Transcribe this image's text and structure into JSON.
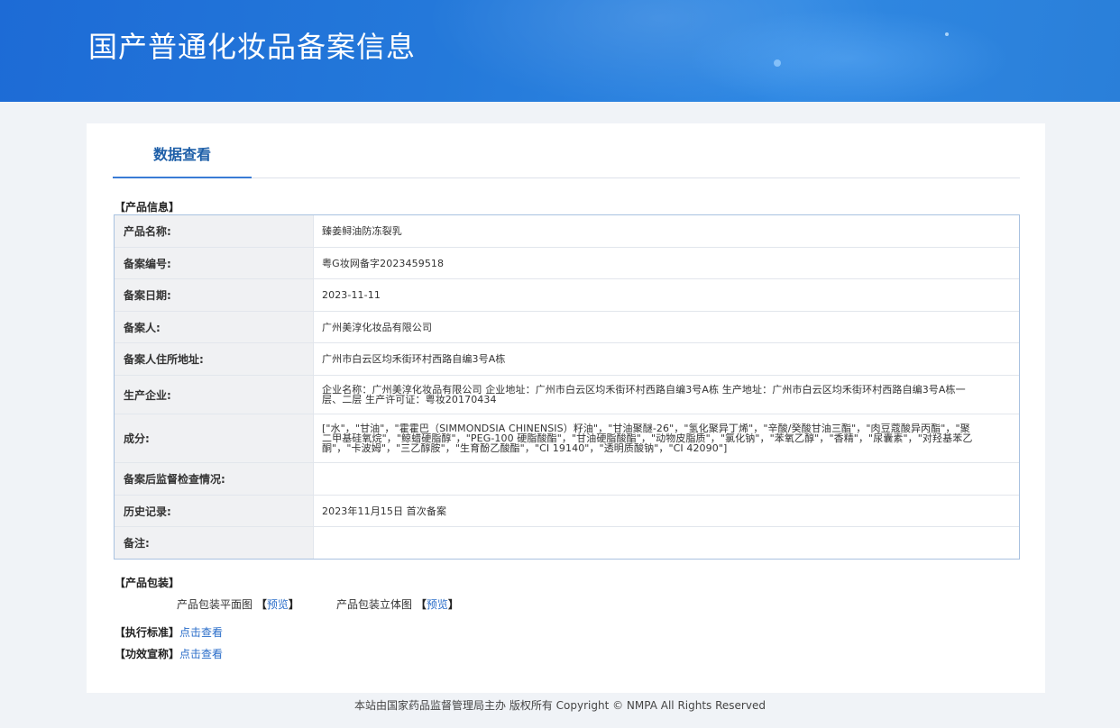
{
  "header": {
    "title": "国产普通化妆品备案信息"
  },
  "tab": {
    "label": "数据查看"
  },
  "product_section_label": "【产品信息】",
  "rows": [
    {
      "key": "产品名称:",
      "value": "臻姜鲟油防冻裂乳"
    },
    {
      "key": "备案编号:",
      "value": "粤G妆网备字2023459518"
    },
    {
      "key": "备案日期:",
      "value": "2023-11-11"
    },
    {
      "key": "备案人:",
      "value": "广州美淳化妆品有限公司"
    },
    {
      "key": "备案人住所地址:",
      "value": "广州市白云区均禾街环村西路自编3号A栋"
    },
    {
      "key": "生产企业:",
      "value": "企业名称：广州美淳化妆品有限公司 企业地址：广州市白云区均禾街环村西路自编3号A栋 生产地址：广州市白云区均禾街环村西路自编3号A栋一层、二层 生产许可证：粤妆20170434"
    },
    {
      "key": "成分:",
      "value": "[\"水\"，\"甘油\"，\"霍霍巴（SIMMONDSIA CHINENSIS）籽油\"，\"甘油聚醚-26\"，\"氢化聚异丁烯\"，\"辛酸/癸酸甘油三酯\"，\"肉豆蔻酸异丙酯\"，\"聚二甲基硅氧烷\"，\"鲸蜡硬脂醇\"，\"PEG-100 硬脂酸酯\"，\"甘油硬脂酸酯\"，\"动物皮脂质\"，\"氯化钠\"，\"苯氧乙醇\"，\"香精\"，\"尿囊素\"，\"对羟基苯乙酮\"，\"卡波姆\"，\"三乙醇胺\"，\"生育酚乙酸酯\"，\"CI 19140\"，\"透明质酸钠\"，\"CI 42090\"]"
    },
    {
      "key": "备案后监督检查情况:",
      "value": ""
    },
    {
      "key": "历史记录:",
      "value": "2023年11月15日 首次备案"
    },
    {
      "key": "备注:",
      "value": ""
    }
  ],
  "packaging": {
    "label": "【产品包装】",
    "flat_label": "产品包装平面图",
    "flat_link": "预览",
    "stereo_label": "产品包装立体图",
    "stereo_link": "预览"
  },
  "standard": {
    "label": "【执行标准】",
    "link": "点击查看"
  },
  "claims": {
    "label": "【功效宣称】",
    "link": "点击查看"
  },
  "footer": {
    "text": "本站由国家药品监督管理局主办 版权所有 Copyright © NMPA All Rights Reserved"
  }
}
